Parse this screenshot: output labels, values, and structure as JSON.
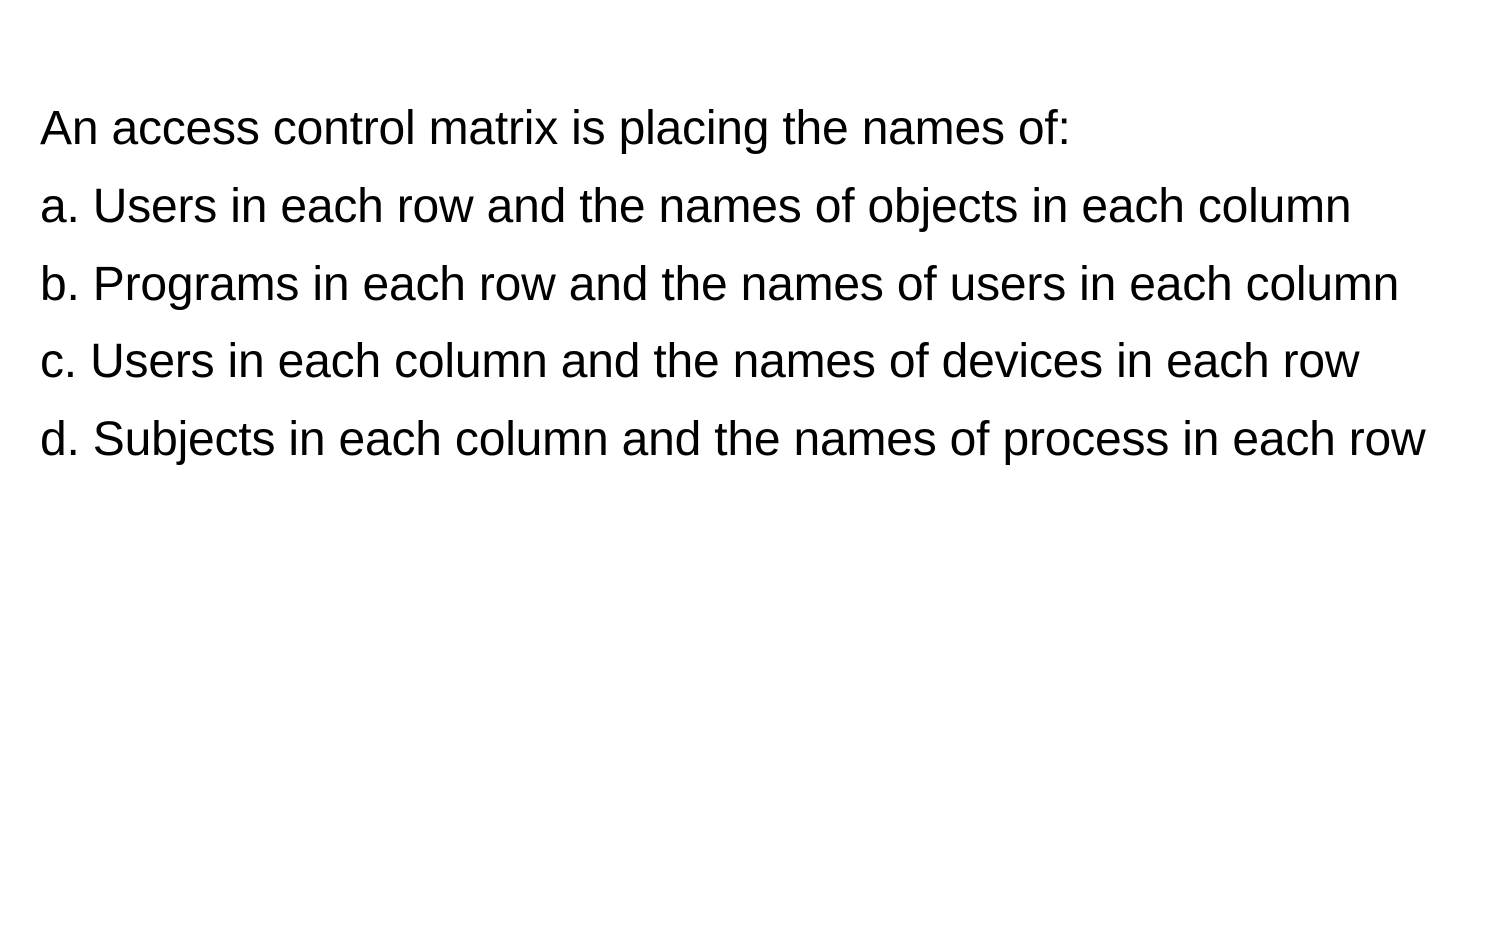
{
  "question": "An access control matrix is placing the names of:",
  "options": {
    "a": "a. Users in each row and the names of objects in each column",
    "b": "b. Programs in each row and the names of users in each column",
    "c": "c. Users in each column and the names of devices in each row",
    "d": "d. Subjects in each column and the names of process in each row"
  }
}
